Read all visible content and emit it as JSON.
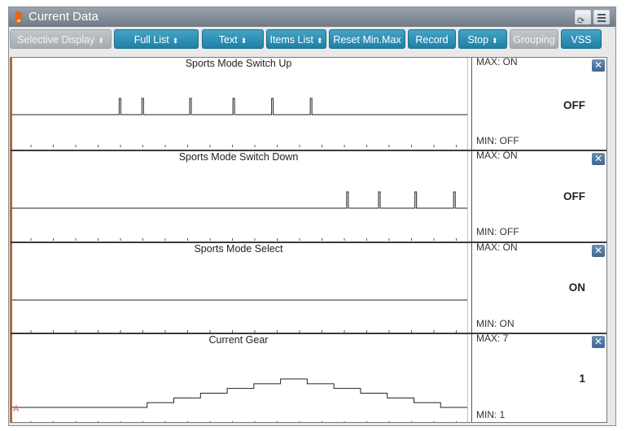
{
  "window": {
    "title": "Current Data",
    "retry_label": "Retry"
  },
  "toolbar": {
    "buttons": [
      {
        "label": "Selective Display",
        "dropdown": true,
        "enabled": false
      },
      {
        "label": "Full List",
        "dropdown": true,
        "enabled": true
      },
      {
        "label": "Text",
        "dropdown": true,
        "enabled": true
      },
      {
        "label": "Items List",
        "dropdown": true,
        "enabled": true
      },
      {
        "label": "Reset Min.Max",
        "dropdown": false,
        "enabled": true
      },
      {
        "label": "Record",
        "dropdown": false,
        "enabled": true
      },
      {
        "label": "Stop",
        "dropdown": true,
        "enabled": true
      },
      {
        "label": "Grouping",
        "dropdown": false,
        "enabled": false
      },
      {
        "label": "VSS",
        "dropdown": false,
        "enabled": true
      }
    ]
  },
  "lanes": [
    {
      "title": "Sports Mode Switch Up",
      "max": "MAX: ON",
      "min": "MIN: OFF",
      "value": "OFF",
      "pulses": [
        0.235,
        0.285,
        0.39,
        0.485,
        0.57,
        0.655
      ]
    },
    {
      "title": "Sports Mode Switch Down",
      "max": "MAX: ON",
      "min": "MIN: OFF",
      "value": "OFF",
      "pulses": [
        0.735,
        0.805,
        0.885,
        0.97
      ]
    },
    {
      "title": "Sports Mode Select",
      "max": "MAX: ON",
      "min": "MIN: ON",
      "value": "ON",
      "pulses": []
    },
    {
      "title": "Current Gear",
      "max": "MAX: 7",
      "min": "MIN: 1",
      "value": "1",
      "gear_steps": [
        1,
        2,
        3,
        4,
        5,
        6,
        7,
        6,
        5,
        4,
        3,
        2,
        1
      ]
    }
  ],
  "colors": {
    "accent": "#1f7fa6",
    "cursor": "#8fd6ee",
    "origin": "#e05a10"
  },
  "marker_label": "A"
}
